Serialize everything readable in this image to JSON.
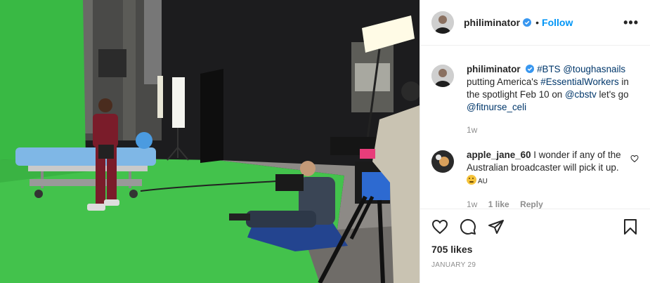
{
  "post": {
    "username": "philiminator",
    "follow_label": "Follow",
    "separator": "•",
    "more_label": "•••"
  },
  "caption": {
    "username": "philiminator",
    "text_parts": {
      "hashtag_bts": "#BTS",
      "mention_tough": "@toughasnails",
      "text_1": "putting America's ",
      "hashtag_workers": "#EssentialWorkers",
      "text_2": " in the spotlight Feb 10 on ",
      "mention_cbs": "@cbstv",
      "text_3": " let's go ",
      "mention_fitnurse": "@fitnurse_celi"
    },
    "time": "1w"
  },
  "comments": [
    {
      "username": "apple_jane_60",
      "text": " I wonder if any of the Australian broadcaster will pick it up.",
      "flag": "AU",
      "time": "1w",
      "likes": "1 like",
      "reply_label": "Reply"
    }
  ],
  "actions": {
    "likes_text": "705 likes",
    "date_text": "January 29"
  },
  "colors": {
    "accent": "#0095f6",
    "tag": "#00376b",
    "muted": "#8e8e8e",
    "greenscreen": "#3fc24a"
  }
}
